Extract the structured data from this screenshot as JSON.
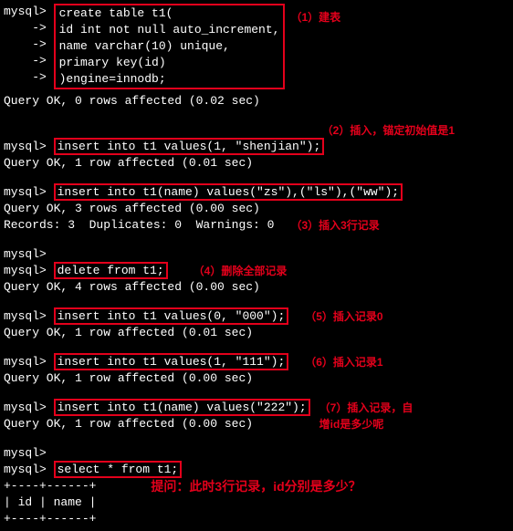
{
  "p": "mysql> ",
  "cont": "    -> ",
  "block1": {
    "l1": "create table t1(",
    "l2": "id int not null auto_increment,",
    "l3": "name varchar(10) unique,",
    "l4": "primary key(id)",
    "l5": ")engine=innodb;"
  },
  "ok0": "Query OK, 0 rows affected (0.02 sec)",
  "ann1": "（1）建表",
  "ann2": "（2）插入，锚定初始值是1",
  "ins1": "insert into t1 values(1, \"shenjian\");",
  "ok1": "Query OK, 1 row affected (0.01 sec)",
  "ins2": "insert into t1(name) values(\"zs\"),(\"ls\"),(\"ww\");",
  "ok3": "Query OK, 3 rows affected (0.00 sec)",
  "rec3": "Records: 3  Duplicates: 0  Warnings: 0",
  "ann3": "（3）插入3行记录",
  "del": "delete from t1;",
  "ann4": "（4）删除全部记录",
  "ok4": "Query OK, 4 rows affected (0.00 sec)",
  "ins000": "insert into t1 values(0, \"000\");",
  "ann5": "（5）插入记录0",
  "ok01": "Query OK, 1 row affected (0.01 sec)",
  "ins111": "insert into t1 values(1, \"111\");",
  "ann6": "（6）插入记录1",
  "ok00": "Query OK, 1 row affected (0.00 sec)",
  "ins222": "insert into t1(name) values(\"222\");",
  "ann7a": "（7）插入记录，自",
  "ann7b": "增id是多少呢",
  "sel": "select * from t1;",
  "border": "+----+------+",
  "header": "| id | name |",
  "question": "提问：此时3行记录，id分别是多少？"
}
